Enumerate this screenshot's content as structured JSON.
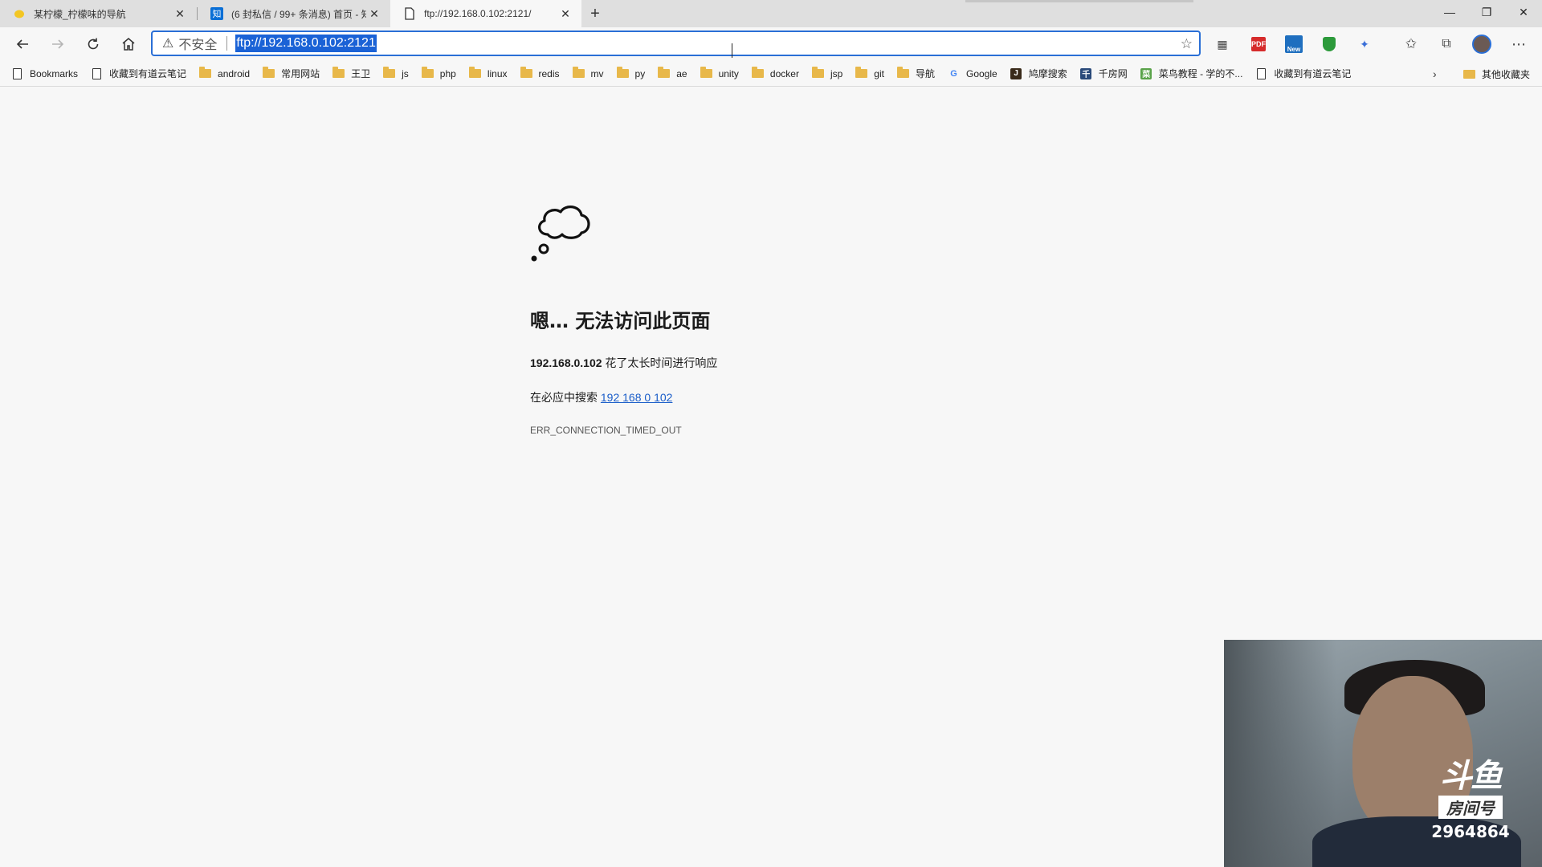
{
  "tabs": [
    {
      "title": "某柠檬_柠檬味的导航",
      "icon": "lemon-icon",
      "active": false
    },
    {
      "title": "(6 封私信 / 99+ 条消息) 首页 - 知",
      "icon": "zhihu-icon",
      "favicon_text": "知",
      "active": false
    },
    {
      "title": "ftp://192.168.0.102:2121/",
      "icon": "page-icon",
      "active": true
    }
  ],
  "window_controls": {
    "minimize": "—",
    "restore": "❐",
    "close": "✕"
  },
  "toolbar": {
    "security_label": "不安全",
    "url": "ftp://192.168.0.102:2121",
    "favorite_star": "☆"
  },
  "extensions": [
    {
      "name": "collections-icon",
      "glyph": "▦"
    },
    {
      "name": "pdf-extension-icon",
      "text": "PDF"
    },
    {
      "name": "new-extension-icon",
      "text": "New"
    },
    {
      "name": "shield-extension-icon"
    },
    {
      "name": "bird-extension-icon",
      "glyph": "✦"
    },
    {
      "name": "favorites-icon",
      "glyph": "✩"
    },
    {
      "name": "collections-panel-icon",
      "glyph": "⧉"
    },
    {
      "name": "profile-avatar"
    },
    {
      "name": "more-menu-icon",
      "glyph": "⋯"
    }
  ],
  "bookmarks": [
    {
      "label": "Bookmarks",
      "type": "page"
    },
    {
      "label": "收藏到有道云笔记",
      "type": "page"
    },
    {
      "label": "android",
      "type": "folder"
    },
    {
      "label": "常用网站",
      "type": "folder"
    },
    {
      "label": "王卫",
      "type": "folder"
    },
    {
      "label": "js",
      "type": "folder"
    },
    {
      "label": "php",
      "type": "folder"
    },
    {
      "label": "linux",
      "type": "folder"
    },
    {
      "label": "redis",
      "type": "folder"
    },
    {
      "label": "mv",
      "type": "folder"
    },
    {
      "label": "py",
      "type": "folder"
    },
    {
      "label": "ae",
      "type": "folder"
    },
    {
      "label": "unity",
      "type": "folder"
    },
    {
      "label": "docker",
      "type": "folder"
    },
    {
      "label": "jsp",
      "type": "folder"
    },
    {
      "label": "git",
      "type": "folder"
    },
    {
      "label": "导航",
      "type": "folder"
    },
    {
      "label": "Google",
      "type": "google"
    },
    {
      "label": "鸠摩搜索",
      "type": "site",
      "badge": "J",
      "color": "#3a2a1a"
    },
    {
      "label": "千房网",
      "type": "site",
      "badge": "千",
      "color": "#2a4a7a"
    },
    {
      "label": "菜鸟教程 - 学的不...",
      "type": "site",
      "badge": "菜",
      "color": "#5aa34a"
    },
    {
      "label": "收藏到有道云笔记",
      "type": "page"
    }
  ],
  "bookmarks_overflow": "›",
  "other_bookmarks": "其他收藏夹",
  "error": {
    "title": "嗯… 无法访问此页面",
    "host": "192.168.0.102",
    "message": " 花了太长时间进行响应",
    "search_prefix": "在必应中搜索 ",
    "search_link": "192 168 0 102",
    "code": "ERR_CONNECTION_TIMED_OUT"
  },
  "stream_overlay": {
    "logo": "斗鱼",
    "room_label": "房间号",
    "room_id": "2964864"
  },
  "colors": {
    "accent": "#1a62d6",
    "link": "#1a5dc9",
    "page_bg": "#f7f7f7",
    "tabstrip_bg": "#dfdfdf"
  }
}
